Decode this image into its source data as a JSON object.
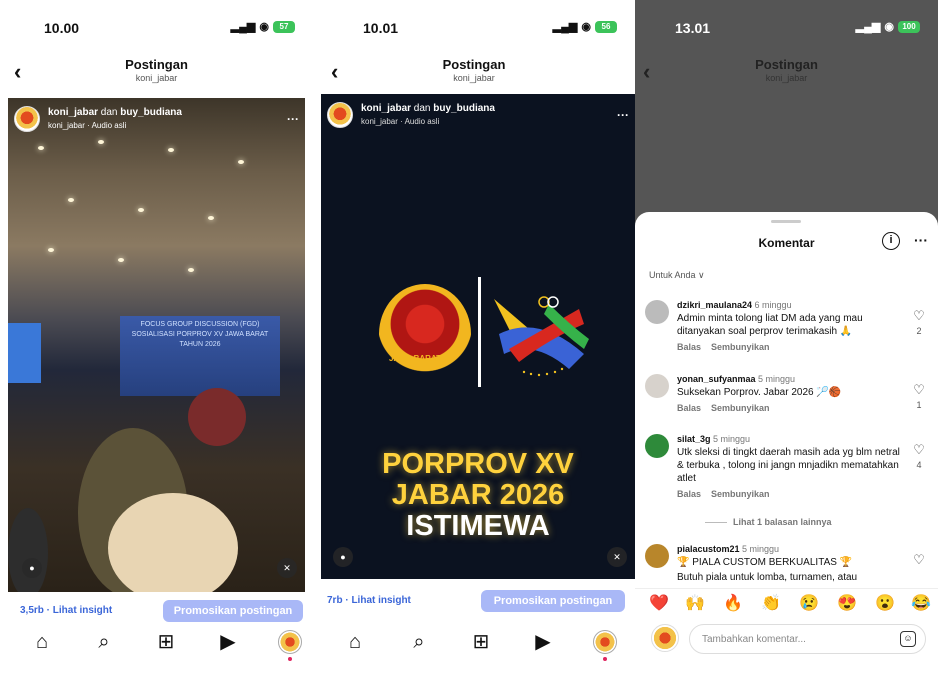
{
  "screens": [
    {
      "time": "10.00",
      "battery": "57",
      "header": {
        "title": "Postingan",
        "subtitle": "koni_jabar"
      },
      "post": {
        "owner": "koni_jabar",
        "conj": " dan ",
        "collab": "buy_budiana",
        "audio": "koni_jabar · Audio asli"
      },
      "banner_text": "FOCUS GROUP DISCUSSION (FGD) SOSIALISASI PORPROV XV JAWA BARAT TAHUN 2026",
      "insight": "3,5rb · Lihat insight",
      "promote": "Promosikan postingan"
    },
    {
      "time": "10.01",
      "battery": "56",
      "header": {
        "title": "Postingan",
        "subtitle": "koni_jabar"
      },
      "post": {
        "owner": "koni_jabar",
        "conj": " dan ",
        "collab": "buy_budiana",
        "audio": "koni_jabar · Audio asli"
      },
      "logo_text": "JAWA BARAT",
      "headline": [
        "PORPROV XV",
        "JABAR 2026",
        "ISTIMEWA"
      ],
      "insight": "7rb · Lihat insight",
      "promote": "Promosikan postingan"
    },
    {
      "time": "13.01",
      "battery": "100",
      "header": {
        "title": "Postingan",
        "subtitle": "koni_jabar"
      },
      "sheet_title": "Komentar",
      "filter": "Untuk Anda ∨",
      "comments": [
        {
          "user": "dzikri_maulana24",
          "ago": " 6 minggu",
          "text": "Admin minta tolong liat DM ada yang mau ditanyakan soal perprov terimakasih 🙏",
          "likes": "2",
          "reply": "Balas",
          "hide": "Sembunyikan"
        },
        {
          "user": "yonan_sufyanmaa",
          "ago": " 5 minggu",
          "text": "Suksekan Porprov. Jabar 2026 🏸🏀",
          "likes": "1",
          "reply": "Balas",
          "hide": "Sembunyikan"
        },
        {
          "user": "silat_3g",
          "ago": " 5 minggu",
          "text": "Utk sleksi di tingkt daerah masih ada yg blm netral & terbuka , tolong ini jangn mnjadikn mematahkan atlet",
          "likes": "4",
          "reply": "Balas",
          "hide": "Sembunyikan"
        },
        {
          "user": "pialacustom21",
          "ago": " 5 minggu",
          "text": "🏆 PIALA CUSTOM BERKUALITAS 🏆",
          "text2": "Butuh piala untuk lomba, turnamen, atau",
          "likes": "",
          "reply": "",
          "hide": ""
        }
      ],
      "more_replies": "Lihat 1 balasan lainnya",
      "emojis": [
        "❤️",
        "🙌",
        "🔥",
        "👏",
        "😢",
        "😍",
        "😮",
        "😂"
      ],
      "input_placeholder": "Tambahkan komentar..."
    }
  ],
  "colors": {
    "accent": "#3b66d8",
    "promo": "#a9b8f7",
    "headline": "#ffd23d"
  }
}
